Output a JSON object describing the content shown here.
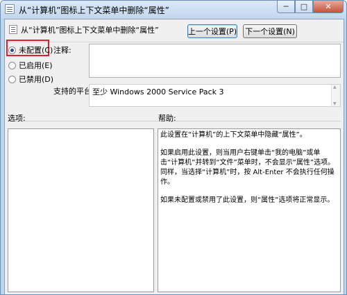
{
  "window": {
    "title": "从“计算机”图标上下文菜单中删除“属性”",
    "icon": "policy-document-icon",
    "minimize_glyph": "─",
    "maximize_glyph": "□",
    "close_glyph": "✕"
  },
  "header": {
    "text": "从“计算机”图标上下文菜单中删除“属性”",
    "icon": "policy-document-icon",
    "prev_button": "上一个设置(P)",
    "next_button": "下一个设置(N)"
  },
  "state": {
    "options": [
      {
        "label": "未配置(C)",
        "checked": true
      },
      {
        "label": "已启用(E)",
        "checked": false
      },
      {
        "label": "已禁用(D)",
        "checked": false
      }
    ]
  },
  "comment": {
    "label": "注释:",
    "value": ""
  },
  "platform": {
    "label": "支持的平台:",
    "value": "至少 Windows 2000 Service Pack 3"
  },
  "options_section": {
    "label": "选项:"
  },
  "help_section": {
    "label": "帮助:",
    "paragraphs": [
      "此设置在“计算机”的上下文菜单中隐藏“属性”。",
      "如果启用此设置，则当用户右键单击“我的电脑”或单击“计算机”并转到“文件”菜单时，不会显示“属性”选项。同样，当选择“计算机”时，按 Alt-Enter 不会执行任何操作。",
      "如果未配置或禁用了此设置，则“属性”选项将正常显示。"
    ]
  },
  "colors": {
    "highlight_border": "#e3202a",
    "window_frame": "#bcd6ee"
  }
}
